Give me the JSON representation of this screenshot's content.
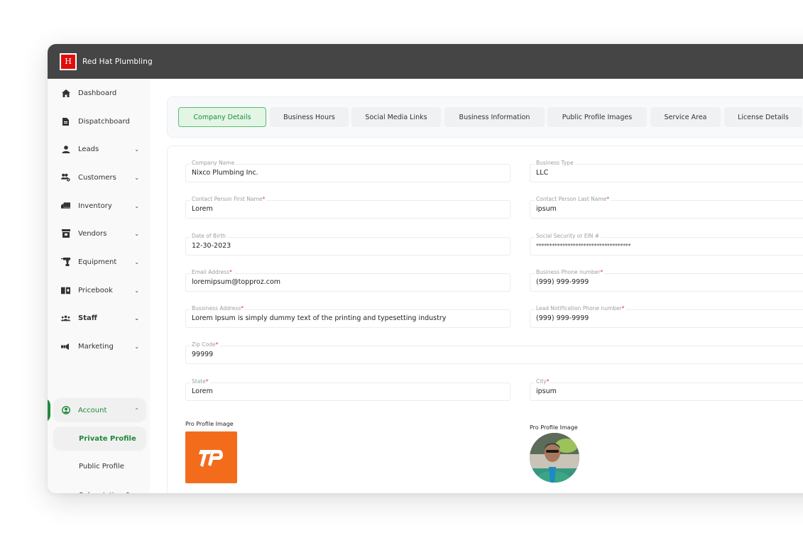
{
  "app": {
    "brand_name": "Red Hat Plumbling",
    "logo_glyph": "H"
  },
  "sidebar": {
    "items": [
      {
        "label": "Dashboard",
        "icon": "home-icon",
        "glyph": "⌂",
        "has_chevron": false
      },
      {
        "label": "Dispatchboard",
        "icon": "document-icon",
        "glyph": "▮",
        "has_chevron": false
      },
      {
        "label": "Leads",
        "icon": "person-icon",
        "glyph": "●",
        "has_chevron": true
      },
      {
        "label": "Customers",
        "icon": "customers-icon",
        "glyph": "👥",
        "has_chevron": true
      },
      {
        "label": "Inventory",
        "icon": "truck-icon",
        "glyph": "▬",
        "has_chevron": true
      },
      {
        "label": "Vendors",
        "icon": "store-icon",
        "glyph": "▦",
        "has_chevron": true
      },
      {
        "label": "Equipment",
        "icon": "drill-icon",
        "glyph": "T",
        "has_chevron": true
      },
      {
        "label": "Pricebook",
        "icon": "book-icon",
        "glyph": "▥",
        "has_chevron": true
      },
      {
        "label": "Staff",
        "icon": "group-icon",
        "glyph": "⁂",
        "has_chevron": true
      },
      {
        "label": "Marketing",
        "icon": "megaphone-icon",
        "glyph": "◀",
        "has_chevron": true
      },
      {
        "label": "Account",
        "icon": "account-circle-icon",
        "glyph": "◉",
        "has_chevron": true,
        "expanded": true,
        "active": true
      }
    ],
    "sub_items": [
      {
        "label": "Private Profile",
        "active": true
      },
      {
        "label": "Public Profile",
        "active": false
      },
      {
        "label": "Subscription & Billing",
        "active": false
      }
    ],
    "chevron_down": "⌄",
    "chevron_up": "⌃"
  },
  "tabs": [
    {
      "label": "Company Details",
      "active": true
    },
    {
      "label": "Business Hours",
      "active": false
    },
    {
      "label": "Social Media Links",
      "active": false
    },
    {
      "label": "Business Information",
      "active": false
    },
    {
      "label": "Public Profile Images",
      "active": false
    },
    {
      "label": "Service Area",
      "active": false
    },
    {
      "label": "License Details",
      "active": false
    }
  ],
  "form": {
    "company_name": {
      "label": "Company Name",
      "required": false,
      "value": "Nixco Plumbing Inc."
    },
    "business_type": {
      "label": "Business Type",
      "required": false,
      "value": "LLC"
    },
    "first_name": {
      "label": "Contact Person First Name",
      "required": true,
      "value": "Lorem"
    },
    "last_name": {
      "label": "Contact Person Last Name",
      "required": true,
      "value": "ipsum"
    },
    "dob": {
      "label": "Date of Birth",
      "required": false,
      "value": "12-30-2023"
    },
    "ssn": {
      "label": "Social Security or EIN #",
      "required": false,
      "value": "************************************"
    },
    "email": {
      "label": "Email Address",
      "required": true,
      "value": "loremipsum@topproz.com"
    },
    "business_phone": {
      "label": "Business Phone number",
      "required": true,
      "value": "(999) 999-9999"
    },
    "address": {
      "label": "Bussiness Address",
      "required": true,
      "value": "Lorem Ipsum is simply dummy text of the printing and typesetting industry"
    },
    "lead_phone": {
      "label": "Lead Notification Phone number",
      "required": true,
      "value": "(999) 999-9999"
    },
    "zip": {
      "label": "Zip Code",
      "required": true,
      "value": "99999"
    },
    "state": {
      "label": "State",
      "required": true,
      "value": "Lorem"
    },
    "city": {
      "label": "City",
      "required": true,
      "value": "ipsum"
    }
  },
  "images": {
    "left_label": "Pro Profile Image",
    "left_logo_text": "TP",
    "right_label": "Pro Profile Image"
  },
  "colors": {
    "accent_green": "#1e8a3a",
    "topbar": "#454545",
    "logo_red": "#e10d0d",
    "pro_logo_orange": "#f36c1c",
    "required_red": "#e53935"
  },
  "required_mark": "*"
}
